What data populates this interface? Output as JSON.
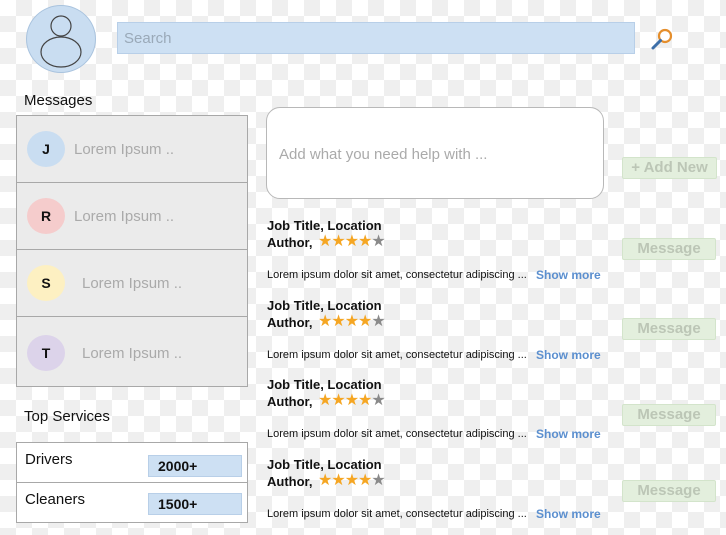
{
  "search": {
    "placeholder": "Search"
  },
  "icons": {
    "avatar": "user-avatar-icon",
    "search": "magnifier-icon",
    "star": "star-icon"
  },
  "messages": {
    "heading": "Messages",
    "items": [
      {
        "initial": "J",
        "preview": "Lorem Ipsum ..",
        "color": "#c9ddf1"
      },
      {
        "initial": "R",
        "preview": "Lorem Ipsum ..",
        "color": "#f5cccc"
      },
      {
        "initial": "S",
        "preview": "Lorem Ipsum ..",
        "color": "#fdf0c2"
      },
      {
        "initial": "T",
        "preview": "Lorem Ipsum ..",
        "color": "#dcd3ea"
      }
    ]
  },
  "services": {
    "heading": "Top Services",
    "items": [
      {
        "name": "Drivers",
        "count": "2000+"
      },
      {
        "name": "Cleaners",
        "count": "1500+"
      }
    ]
  },
  "help": {
    "placeholder": "Add what you need help with ..."
  },
  "add_new": {
    "label": "+ Add New"
  },
  "jobs": [
    {
      "title": "Job Title, Location",
      "author": "Author,",
      "rating": 4.5,
      "max_rating": 5,
      "desc": "Lorem ipsum dolor sit amet, consectetur adipiscing ...",
      "more": "Show more",
      "action": "Message"
    },
    {
      "title": "Job Title, Location",
      "author": "Author,",
      "rating": 4.5,
      "max_rating": 5,
      "desc": "Lorem ipsum dolor sit amet, consectetur adipiscing ...",
      "more": "Show more",
      "action": "Message"
    },
    {
      "title": "Job Title, Location",
      "author": "Author,",
      "rating": 4.5,
      "max_rating": 5,
      "desc": "Lorem ipsum dolor sit amet, consectetur adipiscing ...",
      "more": "Show more",
      "action": "Message"
    },
    {
      "title": "Job Title, Location",
      "author": "Author,",
      "rating": 4.5,
      "max_rating": 5,
      "desc": "Lorem ipsum dolor sit amet, consectetur adipiscing ...",
      "more": "Show more",
      "action": "Message"
    }
  ],
  "colors": {
    "accent_blue": "#cde0f3",
    "link": "#5b8fcf",
    "star": "#f5a623",
    "button_green": "#e3efdd"
  }
}
